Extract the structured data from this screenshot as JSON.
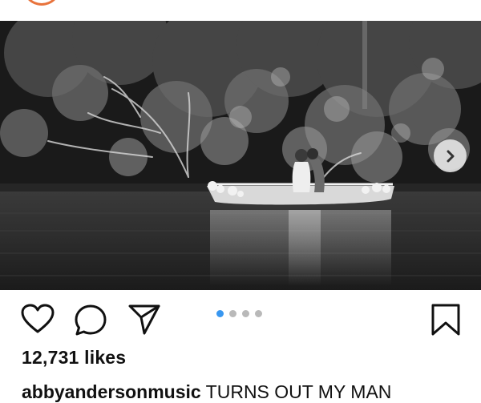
{
  "post": {
    "likes_text": "12,731 likes",
    "username": "abbyandersonmusic",
    "caption": "TURNS OUT MY MAN"
  },
  "carousel": {
    "slide_count": 4,
    "active_index": 0,
    "active_color": "#3897f0",
    "inactive_color": "#b9b9b9"
  },
  "actions": {
    "like_icon": "heart-outline-icon",
    "comment_icon": "comment-bubble-icon",
    "share_icon": "paper-plane-icon",
    "save_icon": "bookmark-outline-icon",
    "next_icon": "chevron-right-icon"
  },
  "colors": {
    "avatar_ring": "#e8733c"
  }
}
